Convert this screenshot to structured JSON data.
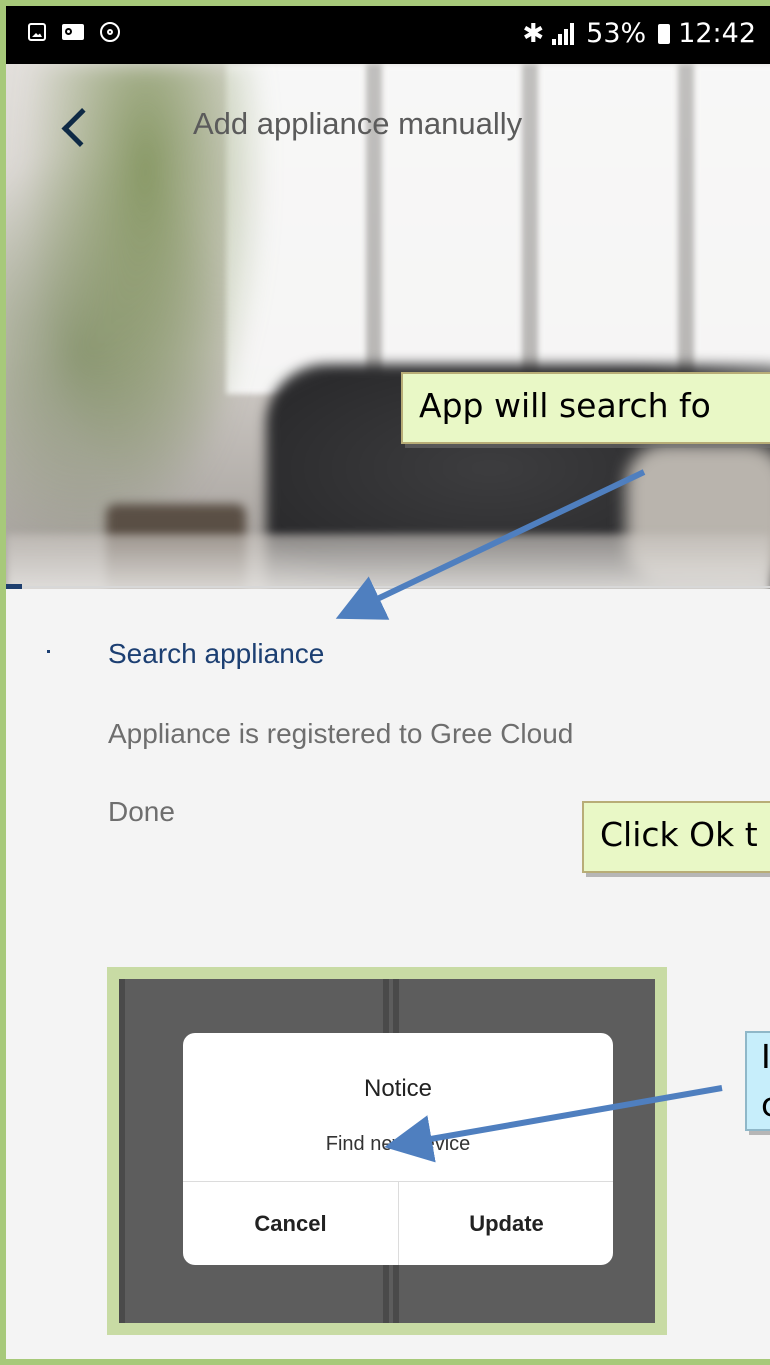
{
  "status_bar": {
    "battery": "53%",
    "time": "12:42",
    "icons": [
      "image-icon",
      "outlook-icon",
      "sync-icon",
      "bluetooth-icon",
      "signal-icon",
      "battery-icon"
    ]
  },
  "header": {
    "title": "Add appliance manually",
    "back_icon": "chevron-left-icon"
  },
  "steps": [
    {
      "label": "Search appliance",
      "state": "active"
    },
    {
      "label": "Appliance is registered to Gree Cloud",
      "state": "pending"
    },
    {
      "label": "Done",
      "state": "pending"
    }
  ],
  "annotations": {
    "callout_1": "App will search fo",
    "callout_2": "Click Ok t",
    "callout_3_line1": "I",
    "callout_3_line2": "c"
  },
  "dialog": {
    "title": "Notice",
    "message": "Find new device",
    "cancel_label": "Cancel",
    "update_label": "Update"
  },
  "colors": {
    "accent": "#1c3f72",
    "callout_green": "#e9f8c6",
    "callout_blue": "#c7eefb",
    "arrow": "#4f7fbf",
    "frame_green": "#a7c97a"
  }
}
